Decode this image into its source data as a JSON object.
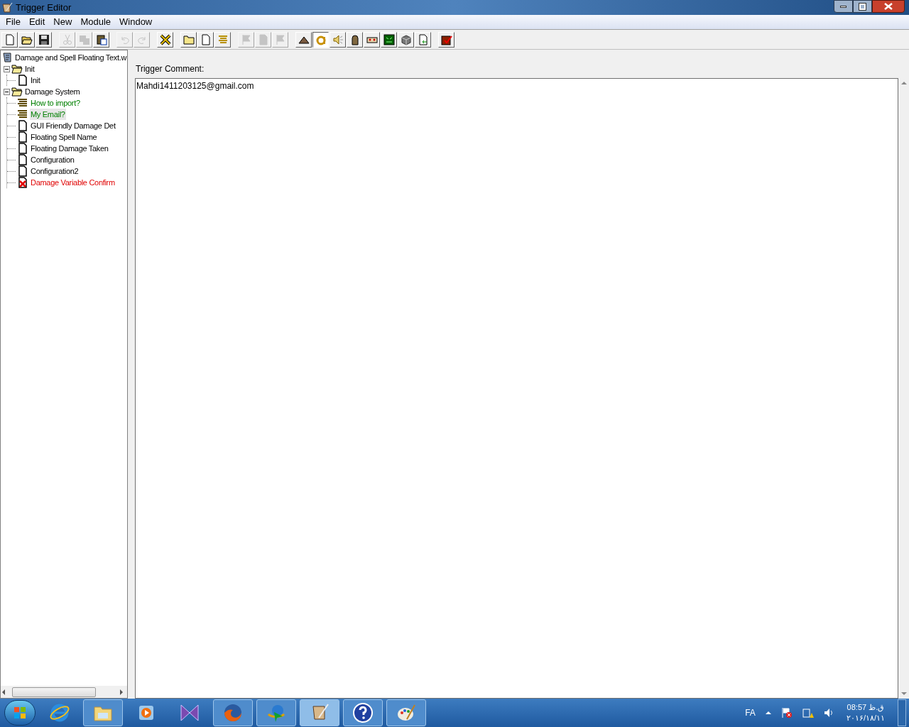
{
  "window": {
    "title": "Trigger Editor"
  },
  "menu": [
    "File",
    "Edit",
    "New",
    "Module",
    "Window"
  ],
  "toolbar": [
    {
      "kind": "new",
      "disabled": false,
      "pressed": false
    },
    {
      "kind": "open",
      "disabled": false,
      "pressed": false
    },
    {
      "kind": "save",
      "disabled": false,
      "pressed": false
    },
    {
      "kind": "sep"
    },
    {
      "kind": "cut",
      "disabled": true,
      "pressed": false
    },
    {
      "kind": "copy",
      "disabled": true,
      "pressed": false
    },
    {
      "kind": "paste",
      "disabled": false,
      "pressed": false
    },
    {
      "kind": "sep"
    },
    {
      "kind": "undo",
      "disabled": true,
      "pressed": false
    },
    {
      "kind": "redo",
      "disabled": true,
      "pressed": false
    },
    {
      "kind": "sep"
    },
    {
      "kind": "x",
      "disabled": false,
      "pressed": false
    },
    {
      "kind": "sep"
    },
    {
      "kind": "folder",
      "disabled": false,
      "pressed": false
    },
    {
      "kind": "page",
      "disabled": false,
      "pressed": false
    },
    {
      "kind": "comment",
      "disabled": false,
      "pressed": false
    },
    {
      "kind": "sep"
    },
    {
      "kind": "flag",
      "disabled": true,
      "pressed": false
    },
    {
      "kind": "page",
      "disabled": true,
      "pressed": false
    },
    {
      "kind": "flag",
      "disabled": true,
      "pressed": false
    },
    {
      "kind": "sep"
    },
    {
      "kind": "terrain",
      "disabled": false,
      "pressed": false
    },
    {
      "kind": "letter",
      "disabled": false,
      "pressed": true
    },
    {
      "kind": "sound",
      "disabled": false,
      "pressed": false
    },
    {
      "kind": "unit",
      "disabled": false,
      "pressed": false
    },
    {
      "kind": "panel",
      "disabled": false,
      "pressed": false
    },
    {
      "kind": "green",
      "disabled": false,
      "pressed": false
    },
    {
      "kind": "cube",
      "disabled": false,
      "pressed": false
    },
    {
      "kind": "import",
      "disabled": false,
      "pressed": false
    },
    {
      "kind": "sep"
    },
    {
      "kind": "test",
      "disabled": false,
      "pressed": false
    }
  ],
  "tree": {
    "label": "Damage and Spell Floating Text.w",
    "children": [
      {
        "kind": "folder",
        "label": "Init",
        "expanded": true,
        "selected": false,
        "children": [
          {
            "kind": "trigger",
            "label": "Init",
            "selected": false
          }
        ]
      },
      {
        "kind": "folder",
        "label": "Damage System",
        "expanded": true,
        "selected": false,
        "children": [
          {
            "kind": "comment",
            "label": "How to import?",
            "selected": false
          },
          {
            "kind": "comment",
            "label": "My Email?",
            "selected": true
          },
          {
            "kind": "trigger",
            "label": "GUI Friendly Damage Det",
            "selected": false
          },
          {
            "kind": "trigger",
            "label": "Floating Spell Name",
            "selected": false
          },
          {
            "kind": "trigger",
            "label": "Floating Damage Taken",
            "selected": false
          },
          {
            "kind": "trigger",
            "label": "Configuration",
            "selected": false
          },
          {
            "kind": "trigger",
            "label": "Configuration2",
            "selected": false
          },
          {
            "kind": "error",
            "label": "Damage Variable Confirm",
            "selected": false
          }
        ]
      }
    ]
  },
  "comment": {
    "label": "Trigger Comment:",
    "value": "Mahdi1411203125@gmail.com"
  },
  "taskbar": {
    "apps": [
      {
        "kind": "ie",
        "open": false
      },
      {
        "kind": "explorer",
        "open": true
      },
      {
        "kind": "media",
        "open": false
      },
      {
        "kind": "bowtie",
        "open": false
      },
      {
        "kind": "firefox",
        "open": true
      },
      {
        "kind": "download",
        "open": true
      },
      {
        "kind": "scroll",
        "open": true,
        "selected": true
      },
      {
        "kind": "help",
        "open": true
      },
      {
        "kind": "paint",
        "open": true
      }
    ],
    "language": "FA",
    "time": "08:57 ق.ظ",
    "date": "۲۰۱۶/۱۸/۱۱"
  }
}
